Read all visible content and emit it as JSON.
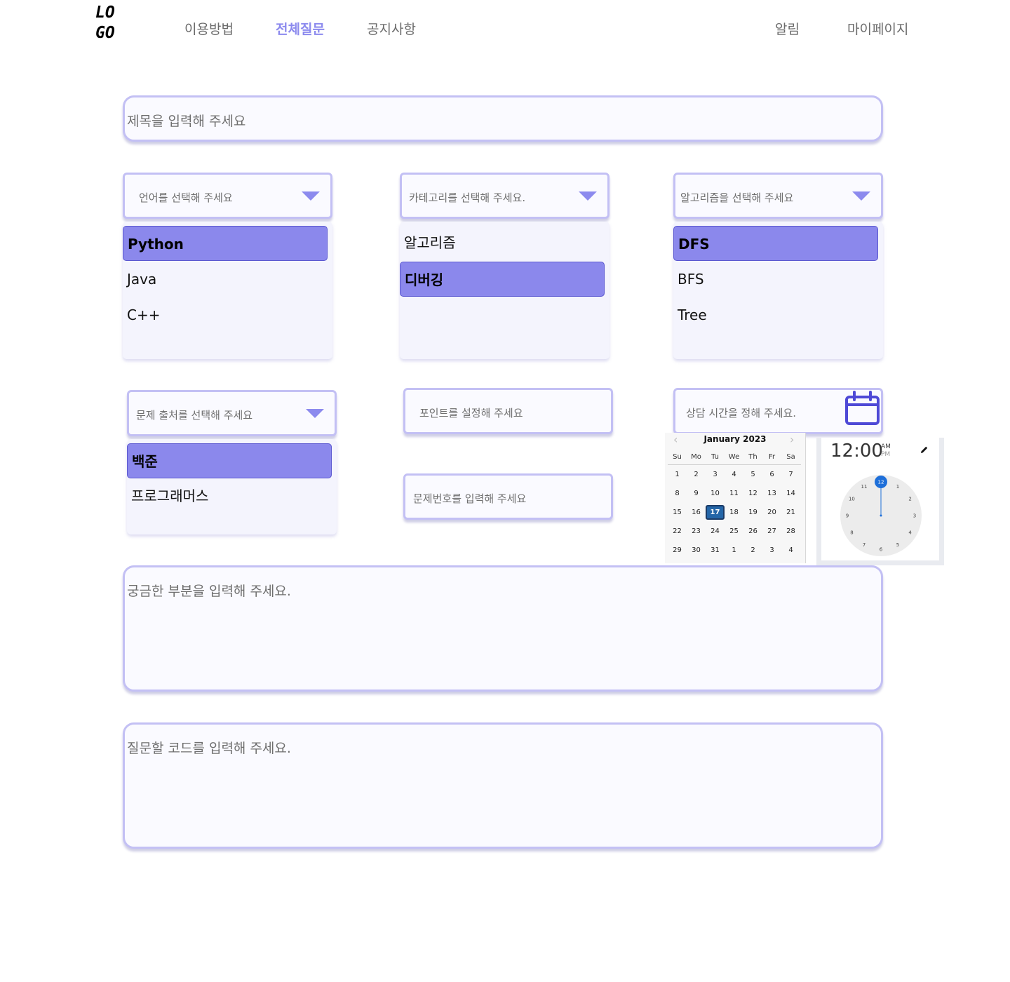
{
  "header": {
    "logo": [
      "LO",
      "GO"
    ],
    "nav": [
      {
        "label": "이용방법",
        "active": false
      },
      {
        "label": "전체질문",
        "active": true
      },
      {
        "label": "공지사항",
        "active": false
      }
    ],
    "right": [
      "알림",
      "마이페이지"
    ]
  },
  "title_placeholder": "제목을 입력해 주세요",
  "language": {
    "placeholder": "언어를 선택해 주세요",
    "options": [
      "Python",
      "Java",
      "C++"
    ],
    "selected": "Python"
  },
  "category": {
    "placeholder": "카테고리를 선택해 주세요.",
    "options": [
      "알고리즘",
      "디버깅"
    ],
    "selected": "디버깅"
  },
  "algorithm": {
    "placeholder": "알고리즘을 선택해 주세요",
    "options": [
      "DFS",
      "BFS",
      "Tree"
    ],
    "selected": "DFS"
  },
  "source": {
    "placeholder": "문제 출처를 선택해 주세요",
    "options": [
      "백준",
      "프로그래머스"
    ],
    "selected": "백준"
  },
  "points_placeholder": "포인트를 설정해 주세요",
  "problem_no_placeholder": "문제번호를 입력해 주세요",
  "consult_time_placeholder": "상담 시간을 정해 주세요.",
  "calendar": {
    "month_label": "January 2023",
    "weekdays": [
      "Su",
      "Mo",
      "Tu",
      "We",
      "Th",
      "Fr",
      "Sa"
    ],
    "weeks": [
      [
        "1",
        "2",
        "3",
        "4",
        "5",
        "6",
        "7"
      ],
      [
        "8",
        "9",
        "10",
        "11",
        "12",
        "13",
        "14"
      ],
      [
        "15",
        "16",
        "17",
        "18",
        "19",
        "20",
        "21"
      ],
      [
        "22",
        "23",
        "24",
        "25",
        "26",
        "27",
        "28"
      ],
      [
        "29",
        "30",
        "31",
        "1",
        "2",
        "3",
        "4"
      ]
    ],
    "selected_day": "17"
  },
  "time": {
    "display": "12:00",
    "am": "AM",
    "pm": "PM",
    "hours": [
      "12",
      "1",
      "2",
      "3",
      "4",
      "5",
      "6",
      "7",
      "8",
      "9",
      "10",
      "11"
    ]
  },
  "question_placeholder": "궁금한 부분을 입력해 주세요.",
  "code_placeholder": "질문할 코드를 입력해 주세요.",
  "colors": {
    "accent": "#8c8aee",
    "border": "#c3c0f4",
    "selected_fill": "#8b88ec",
    "calendar_today": "#2466a8",
    "clock_hand": "#1e6fd9"
  }
}
